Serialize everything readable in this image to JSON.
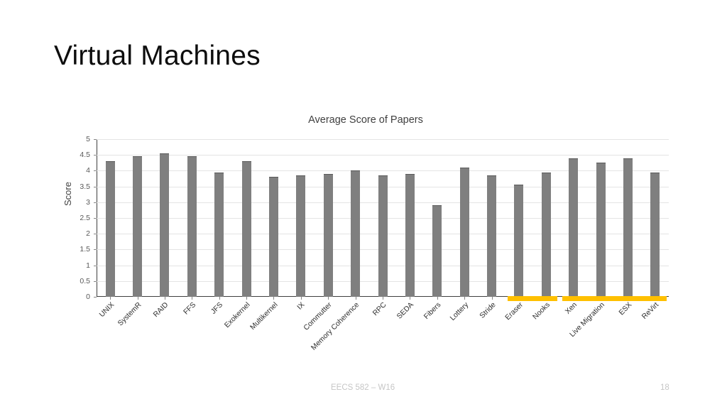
{
  "slide": {
    "title": "Virtual Machines"
  },
  "footer": {
    "course": "EECS 582 – W16",
    "page_number": "18"
  },
  "chart_data": {
    "type": "bar",
    "title": "Average Score of Papers",
    "xlabel": "",
    "ylabel": "Score",
    "ylim": [
      0,
      5
    ],
    "ytick_step": 0.5,
    "yticks": [
      "0",
      "0.5",
      "1",
      "1.5",
      "2",
      "2.5",
      "3",
      "3.5",
      "4",
      "4.5",
      "5"
    ],
    "grid": true,
    "legend": "none",
    "bar_color": "#7f7f7f",
    "highlight_color": "#ffc000",
    "categories": [
      "UNIX",
      "SystemR",
      "RAID",
      "FFS",
      "JFS",
      "Exokernel",
      "Multikernel",
      "IX",
      "Commutter",
      "Memory Coherence",
      "RPC",
      "SEDA",
      "Fibers",
      "Lottery",
      "Stride",
      "Eraser",
      "Nooks",
      "Xen",
      "Live Migration",
      "ESX",
      "ReVirt"
    ],
    "values": [
      4.3,
      4.45,
      4.55,
      4.45,
      3.95,
      4.3,
      3.8,
      3.85,
      3.9,
      4.0,
      3.85,
      3.9,
      2.9,
      4.1,
      3.85,
      3.55,
      3.95,
      4.4,
      4.25,
      4.4,
      3.95
    ],
    "highlight_groups": [
      {
        "label": "Eraser-Nooks",
        "start_index": 15,
        "end_index": 16
      },
      {
        "label": "Xen-ReVirt",
        "start_index": 17,
        "end_index": 20
      }
    ]
  }
}
